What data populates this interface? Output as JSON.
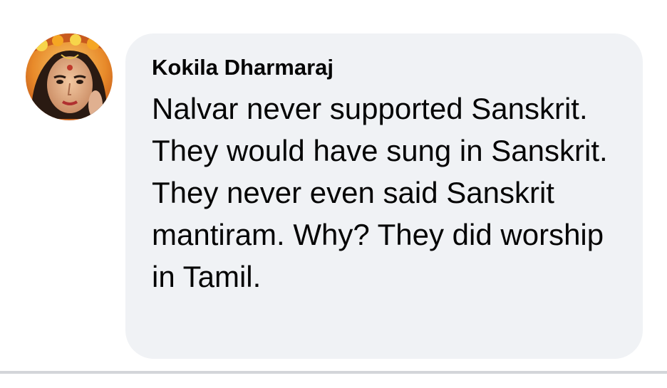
{
  "comment": {
    "author": "Kokila Dharmaraj",
    "text": "Nalvar never supported Sanskrit. They would have sung in Sanskrit. They never even said Sanskrit mantiram. Why? They did worship in Tamil.",
    "avatar_icon": "profile-photo",
    "bubble_color": "#f0f2f5"
  }
}
